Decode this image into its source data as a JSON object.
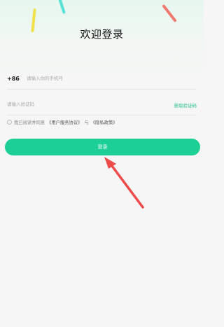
{
  "page": {
    "title": "欢迎登录"
  },
  "form": {
    "country_code": "+86",
    "phone_placeholder": "请输入你的手机号",
    "code_placeholder": "请输入验证码",
    "get_code_label": "获取验证码"
  },
  "agreement": {
    "prefix": "我已阅读并同意",
    "terms_link": "《用户服务协议》",
    "conjunction": "与",
    "privacy_link": "《隐私政策》"
  },
  "login_button": {
    "label": "登录"
  },
  "colors": {
    "accent": "#1ccf95",
    "link_accent": "#21c08b",
    "annotation_arrow": "#f04b4b"
  },
  "icons": {
    "annotation": "red-arrow-pointing-at-login-button"
  }
}
